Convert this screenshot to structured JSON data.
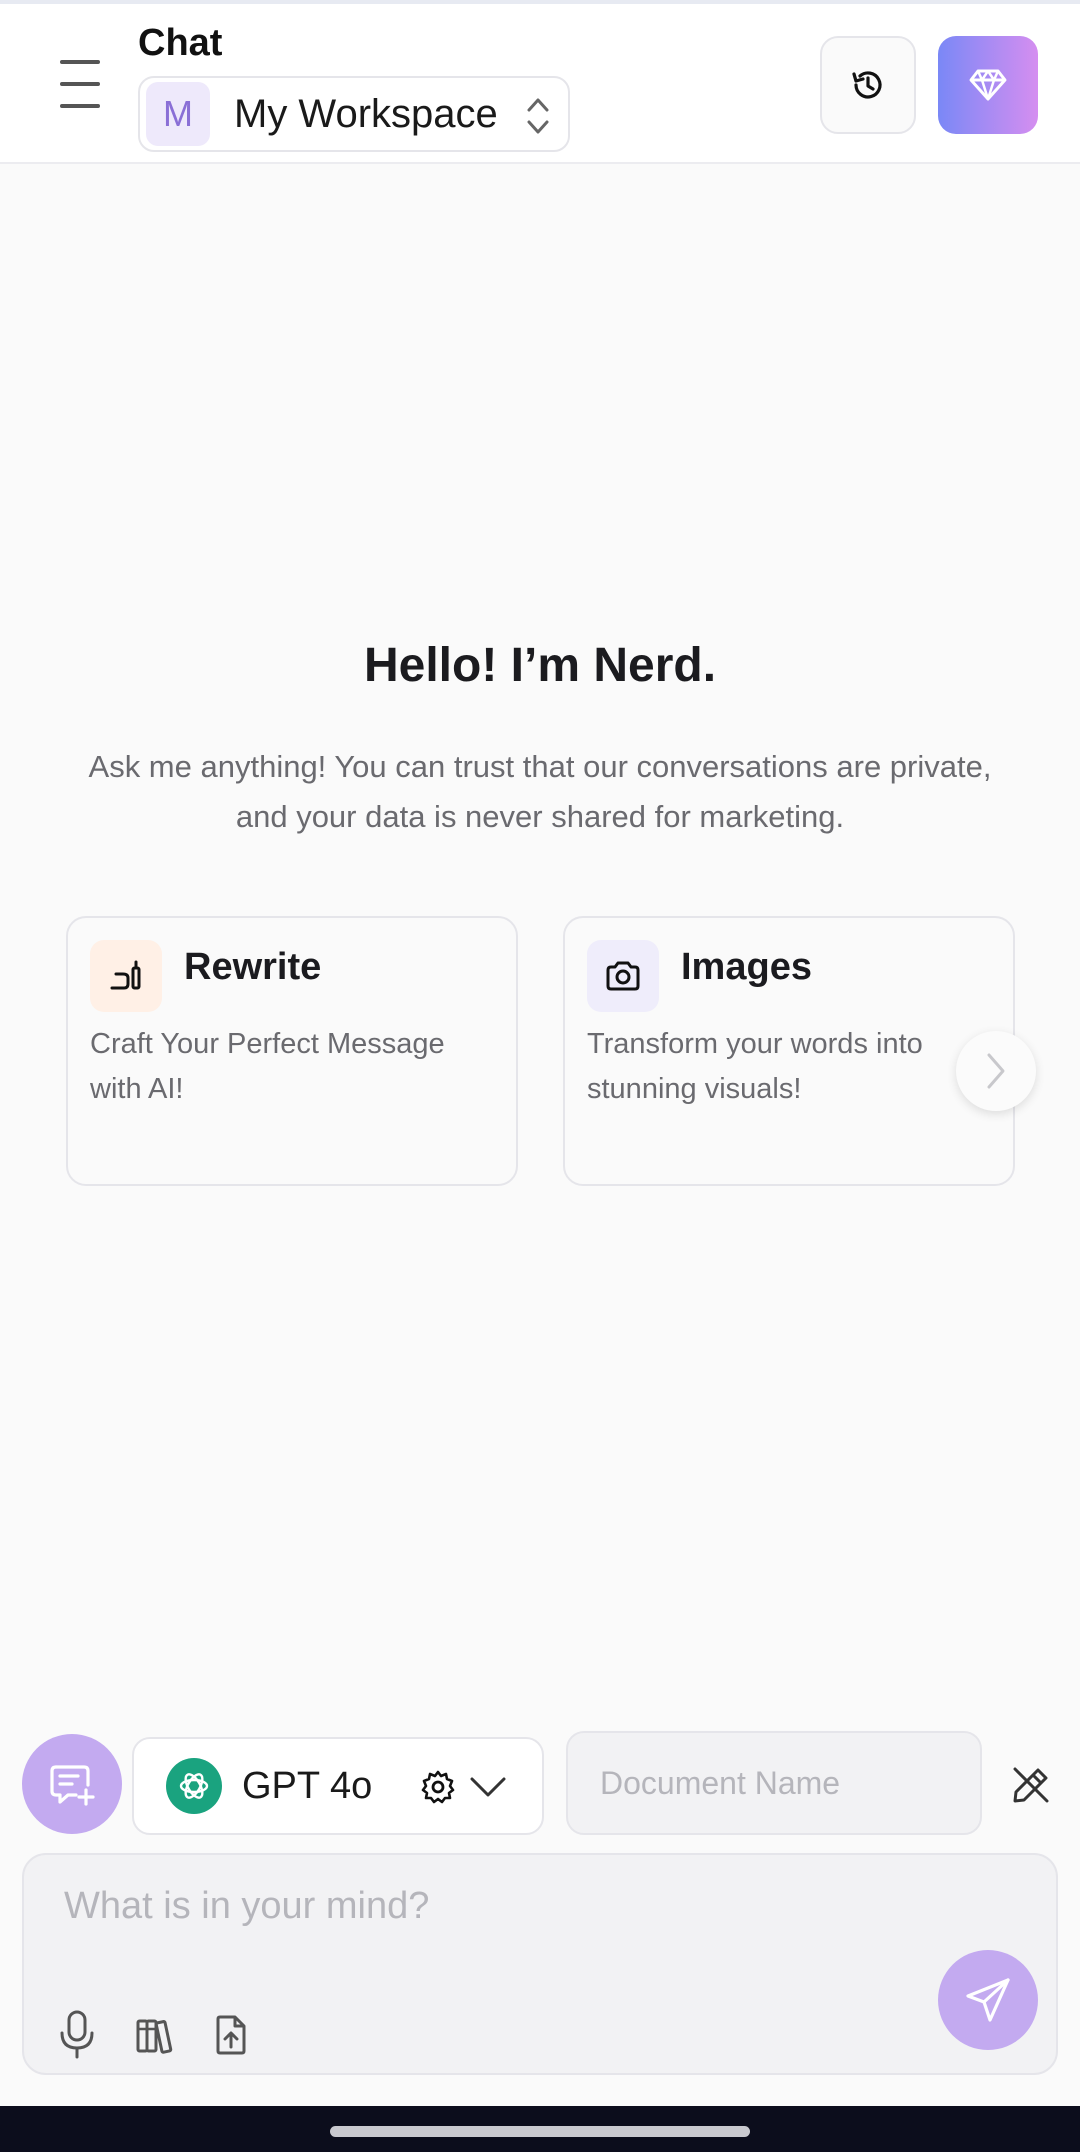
{
  "header": {
    "title": "Chat",
    "workspace": {
      "avatar_letter": "M",
      "name": "My Workspace"
    },
    "icons": {
      "menu": "hamburger-menu-icon",
      "history": "history-icon",
      "premium": "diamond-icon"
    }
  },
  "hero": {
    "title": "Hello! I’m Nerd.",
    "subtitle": "Ask me anything! You can trust that our conversations are private, and your data is never shared for marketing."
  },
  "cards": [
    {
      "title": "Rewrite",
      "desc": "Craft Your Perfect Message with AI!",
      "icon": "rewrite-icon"
    },
    {
      "title": "Images",
      "desc": "Transform your words into stunning visuals!",
      "icon": "camera-icon"
    }
  ],
  "controls": {
    "model": {
      "name": "GPT 4o",
      "icon": "openai-logo-icon"
    },
    "document_name_placeholder": "Document Name",
    "input_placeholder": "What is in your mind?"
  },
  "colors": {
    "accent": "#c3aaf0",
    "premium_gradient_start": "#7a88f6",
    "premium_gradient_end": "#d58ef0",
    "model_logo": "#1aa37f",
    "background": "#fafafa"
  }
}
